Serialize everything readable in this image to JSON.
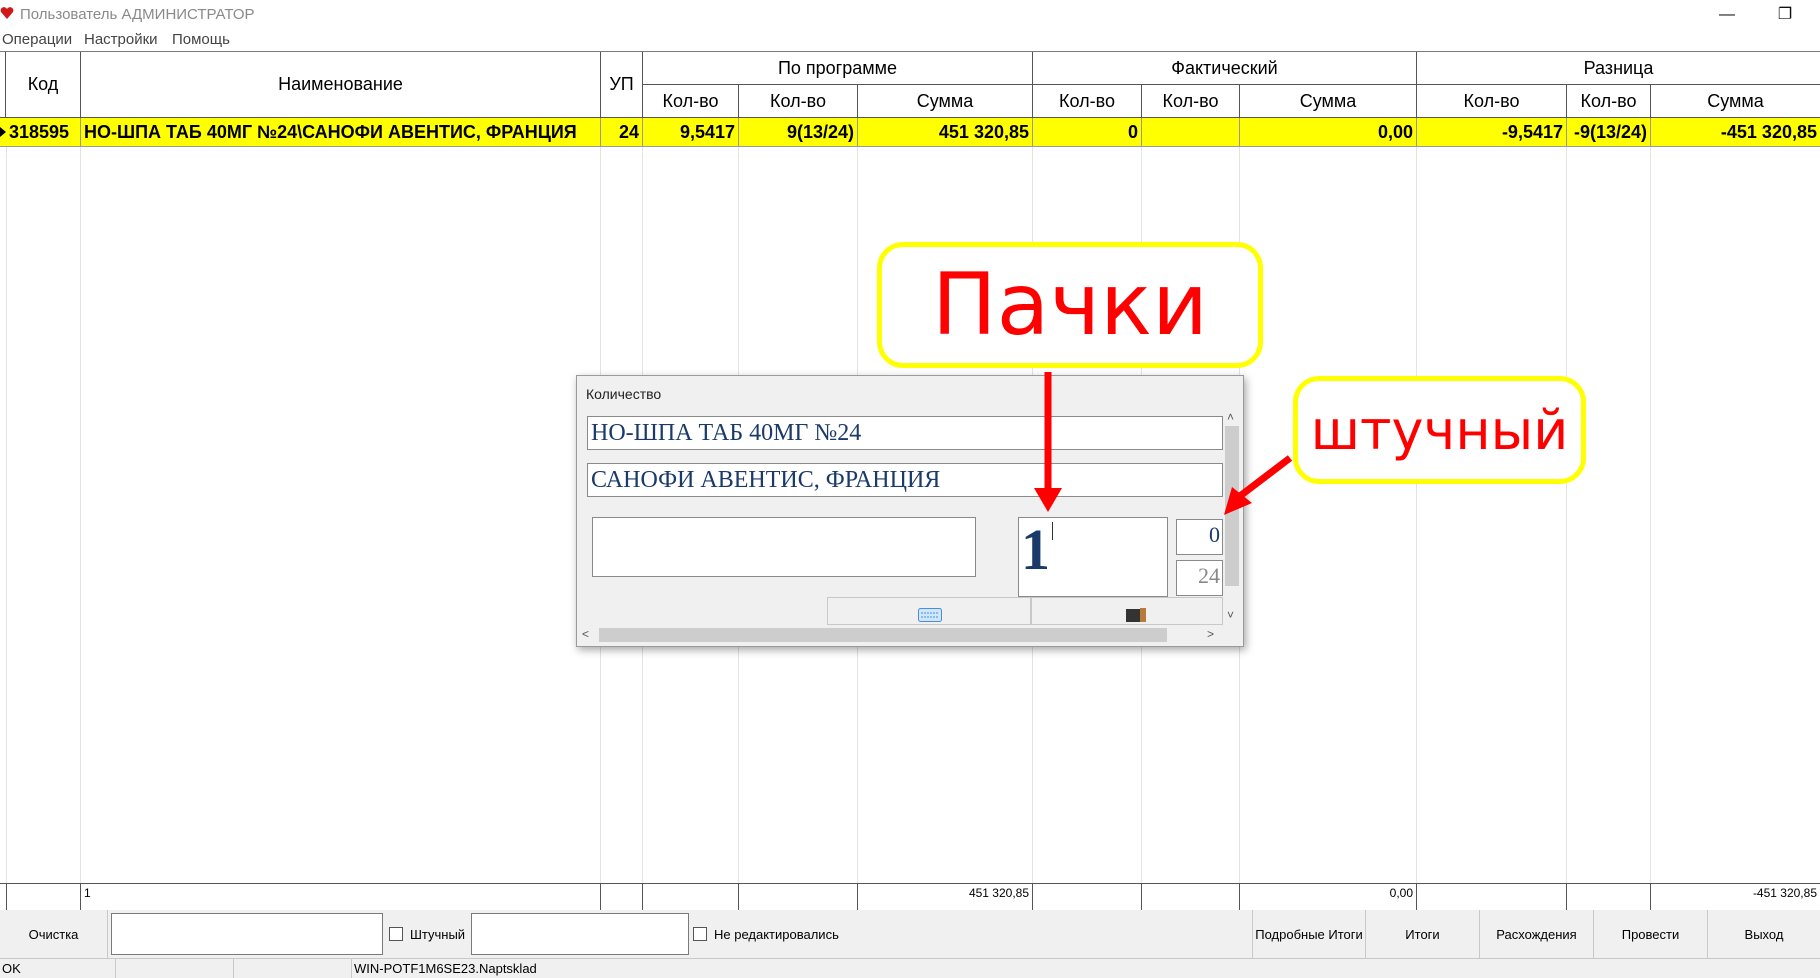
{
  "window": {
    "title": "Пользователь АДМИНИСТРАТОР",
    "minimize_glyph": "—",
    "maximize_glyph": "❐"
  },
  "menu": {
    "items": [
      "Операции",
      "Настройки",
      "Помощь"
    ]
  },
  "grid": {
    "headers": {
      "kod": "Код",
      "name": "Наименование",
      "up": "УП",
      "group_program": "По программе",
      "group_fact": "Фактический",
      "group_diff": "Разница",
      "kolvo": "Кол-во",
      "summa": "Сумма"
    },
    "row": {
      "kod": "318595",
      "name": "НО-ШПА ТАБ 40МГ №24\\САНОФИ АВЕНТИС, ФРАНЦИЯ",
      "up": "24",
      "p_qty1": "9,5417",
      "p_qty2": "9(13/24)",
      "p_sum": "451 320,85",
      "f_qty1": "0",
      "f_qty2": "",
      "f_sum": "0,00",
      "d_qty1": "-9,5417",
      "d_qty2": "-9(13/24)",
      "d_sum": "-451 320,85"
    },
    "totals": {
      "name": "1",
      "p_sum": "451 320,85",
      "f_sum": "0,00",
      "d_sum": "-451 320,85"
    },
    "selected_row_color": "#ffff00"
  },
  "toolbar": {
    "clear_label": "Очистка",
    "piece_label": "Штучный",
    "not_edited_label": "Не редактировались",
    "detailed_totals_label": "Подробные Итоги",
    "totals_label": "Итоги",
    "discrepancies_label": "Расхождения",
    "post_label": "Провести",
    "exit_label": "Выход"
  },
  "status": {
    "ok": "OK",
    "server": "WIN-POTF1M6SE23.Naptsklad"
  },
  "dialog": {
    "title": "Количество",
    "product_name": "НО-ШПА ТАБ 40МГ №24",
    "manufacturer": "САНОФИ АВЕНТИС, ФРАНЦИЯ",
    "packs_value": "1",
    "pieces_value": "0",
    "pack_size": "24",
    "keyboard_icon": "keyboard-icon",
    "book_icon": "book-icon"
  },
  "annotations": {
    "packs": "Пачки",
    "pieces": "штучный",
    "arrow_color": "#ff0000",
    "callout_border": "#ffff00"
  }
}
